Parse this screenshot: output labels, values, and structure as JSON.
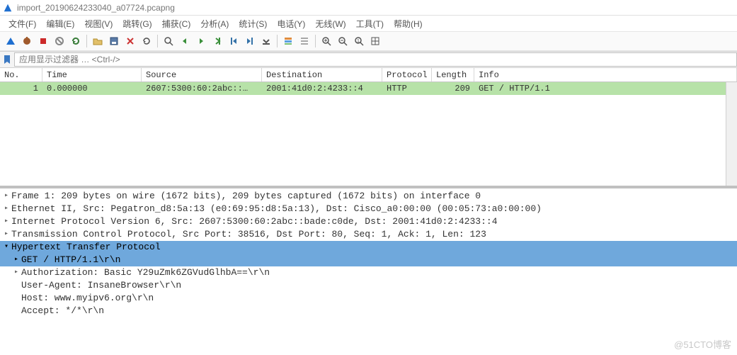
{
  "window": {
    "title": "import_20190624233040_a07724.pcapng"
  },
  "menu": {
    "items": [
      "文件(F)",
      "编辑(E)",
      "视图(V)",
      "跳转(G)",
      "捕获(C)",
      "分析(A)",
      "统计(S)",
      "电话(Y)",
      "无线(W)",
      "工具(T)",
      "帮助(H)"
    ]
  },
  "filter": {
    "placeholder": "应用显示过滤器 … <Ctrl-/>"
  },
  "packet_list": {
    "columns": [
      "No.",
      "Time",
      "Source",
      "Destination",
      "Protocol",
      "Length",
      "Info"
    ],
    "rows": [
      {
        "no": "1",
        "time": "0.000000",
        "src": "2607:5300:60:2abc::…",
        "dst": "2001:41d0:2:4233::4",
        "prot": "HTTP",
        "len": "209",
        "info": "GET / HTTP/1.1",
        "selected": true
      }
    ]
  },
  "details": [
    {
      "level": 0,
      "exp": ">",
      "text": "Frame 1: 209 bytes on wire (1672 bits), 209 bytes captured (1672 bits) on interface 0"
    },
    {
      "level": 0,
      "exp": ">",
      "text": "Ethernet II, Src: Pegatron_d8:5a:13 (e0:69:95:d8:5a:13), Dst: Cisco_a0:00:00 (00:05:73:a0:00:00)"
    },
    {
      "level": 0,
      "exp": ">",
      "text": "Internet Protocol Version 6, Src: 2607:5300:60:2abc::bade:c0de, Dst: 2001:41d0:2:4233::4"
    },
    {
      "level": 0,
      "exp": ">",
      "text": "Transmission Control Protocol, Src Port: 38516, Dst Port: 80, Seq: 1, Ack: 1, Len: 123"
    },
    {
      "level": 0,
      "exp": "v",
      "text": "Hypertext Transfer Protocol",
      "hl": true
    },
    {
      "level": 1,
      "exp": ">",
      "text": "GET / HTTP/1.1\\r\\n",
      "hl": true
    },
    {
      "level": 1,
      "exp": ">",
      "text": "Authorization: Basic Y29uZmk6ZGVudGlhbA==\\r\\n"
    },
    {
      "level": 1,
      "exp": "",
      "text": "User-Agent: InsaneBrowser\\r\\n"
    },
    {
      "level": 1,
      "exp": "",
      "text": "Host: www.myipv6.org\\r\\n"
    },
    {
      "level": 1,
      "exp": "",
      "text": "Accept: */*\\r\\n"
    }
  ],
  "watermark": "@51CTO博客",
  "colors": {
    "row_sel": "#b7e2a8",
    "detail_hl": "#6fa8dc"
  }
}
